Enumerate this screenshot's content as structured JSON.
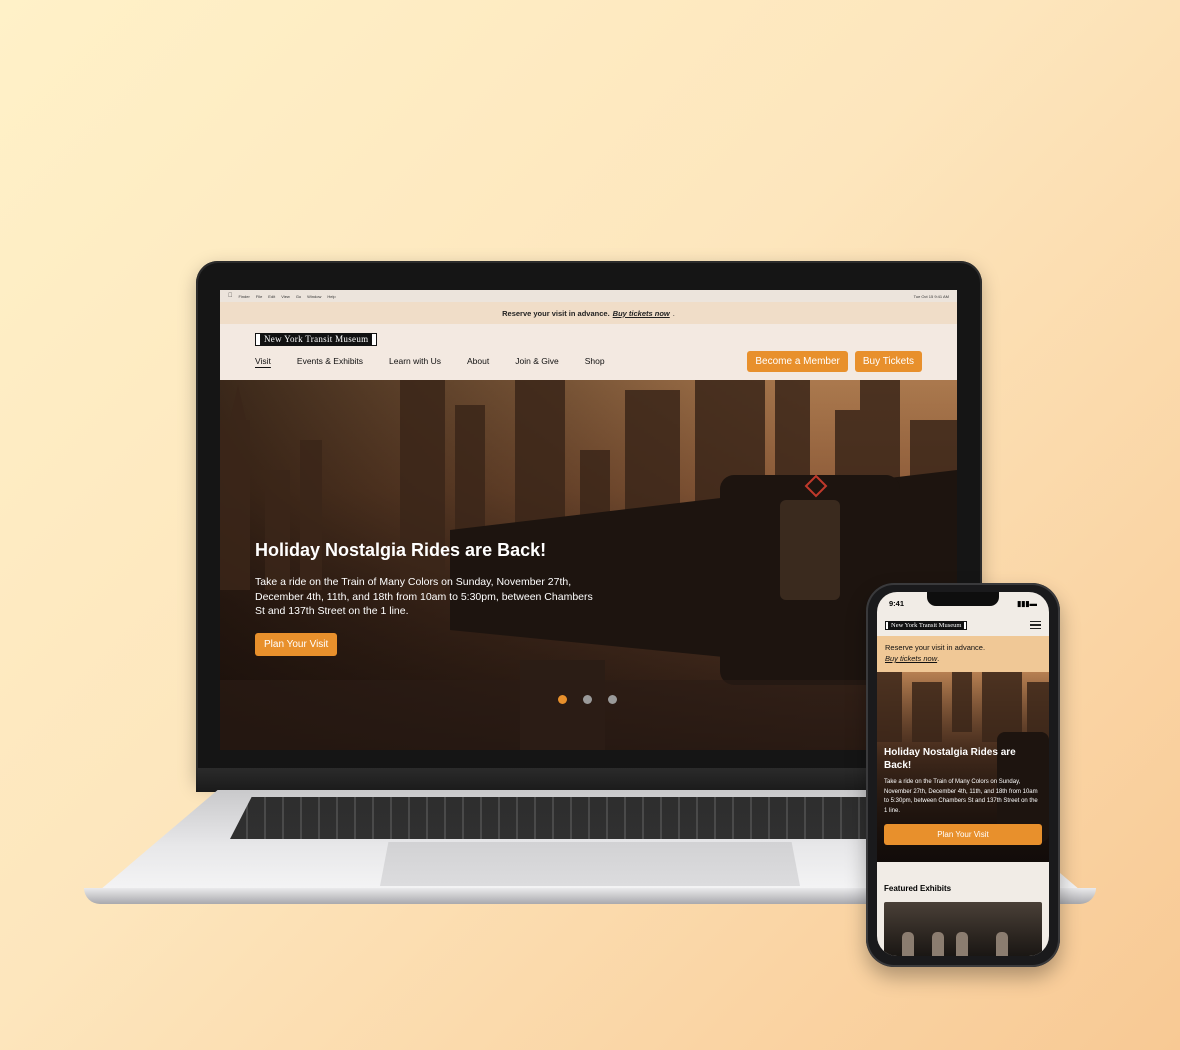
{
  "desktop": {
    "menubar": {
      "items": [
        "Finder",
        "File",
        "Edit",
        "View",
        "Go",
        "Window",
        "Help"
      ],
      "clock": "Tue Oct 15 9:41 AM"
    },
    "promo": {
      "message": "Reserve your visit in advance.",
      "link": "Buy tickets now"
    },
    "logo": "New York Transit Museum",
    "nav": {
      "items": [
        "Visit",
        "Events & Exhibits",
        "Learn with Us",
        "About",
        "Join & Give",
        "Shop"
      ],
      "active": "Visit"
    },
    "buttons": {
      "member": "Become a Member",
      "tickets": "Buy Tickets"
    },
    "hero": {
      "title": "Holiday Nostalgia Rides are Back!",
      "text": "Take a ride on the Train of Many Colors on Sunday, November 27th, December 4th, 11th, and 18th from 10am to 5:30pm, between Chambers St and 137th Street on the 1 line.",
      "cta": "Plan Your Visit",
      "slides": 3,
      "active_slide": 1
    }
  },
  "mobile": {
    "time": "9:41",
    "logo": "New York Transit Museum",
    "promo": {
      "message": "Reserve your visit in advance.",
      "link": "Buy tickets now"
    },
    "hero": {
      "title": "Holiday Nostalgia Rides are Back!",
      "text": "Take a ride on the Train of Many Colors on Sunday, November 27th, December 4th, 11th, and 18th from 10am to 5:30pm, between Chambers St and 137th Street on the 1 line.",
      "cta": "Plan Your Visit"
    },
    "section_title": "Featured Exhibits",
    "menu_icon": "hamburger-icon"
  },
  "colors": {
    "accent": "#e8902c",
    "promo_bg": "#f0ddc8",
    "mobile_promo_bg": "#f0c896",
    "background_start": "#fff1c8",
    "background_end": "#f8c994"
  }
}
